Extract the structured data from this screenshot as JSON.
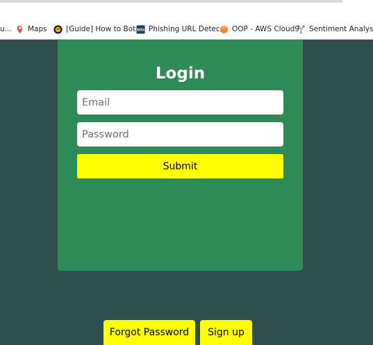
{
  "bookmarks": [
    {
      "label": "u...",
      "icon": "truncated-bookmark-icon"
    },
    {
      "label": "Maps",
      "icon": "google-maps-icon"
    },
    {
      "label": "[Guide] How to Bot...",
      "icon": "bot-guide-icon"
    },
    {
      "label": "Phishing URL Detec...",
      "icon": "phishing-site-icon"
    },
    {
      "label": "OOP - AWS Cloud9",
      "icon": "aws-cloud9-icon"
    },
    {
      "label": "Sentiment Analysis...",
      "icon": "sentiment-analysis-icon"
    }
  ],
  "login": {
    "title": "Login",
    "email_placeholder": "Email",
    "password_placeholder": "Password",
    "submit_label": "Submit"
  },
  "links": {
    "forgot_password_label": "Forgot Password",
    "sign_up_label": "Sign up"
  },
  "colors": {
    "background": "#2f4f4f",
    "card": "#2e8b57",
    "button": "#ffff00"
  }
}
